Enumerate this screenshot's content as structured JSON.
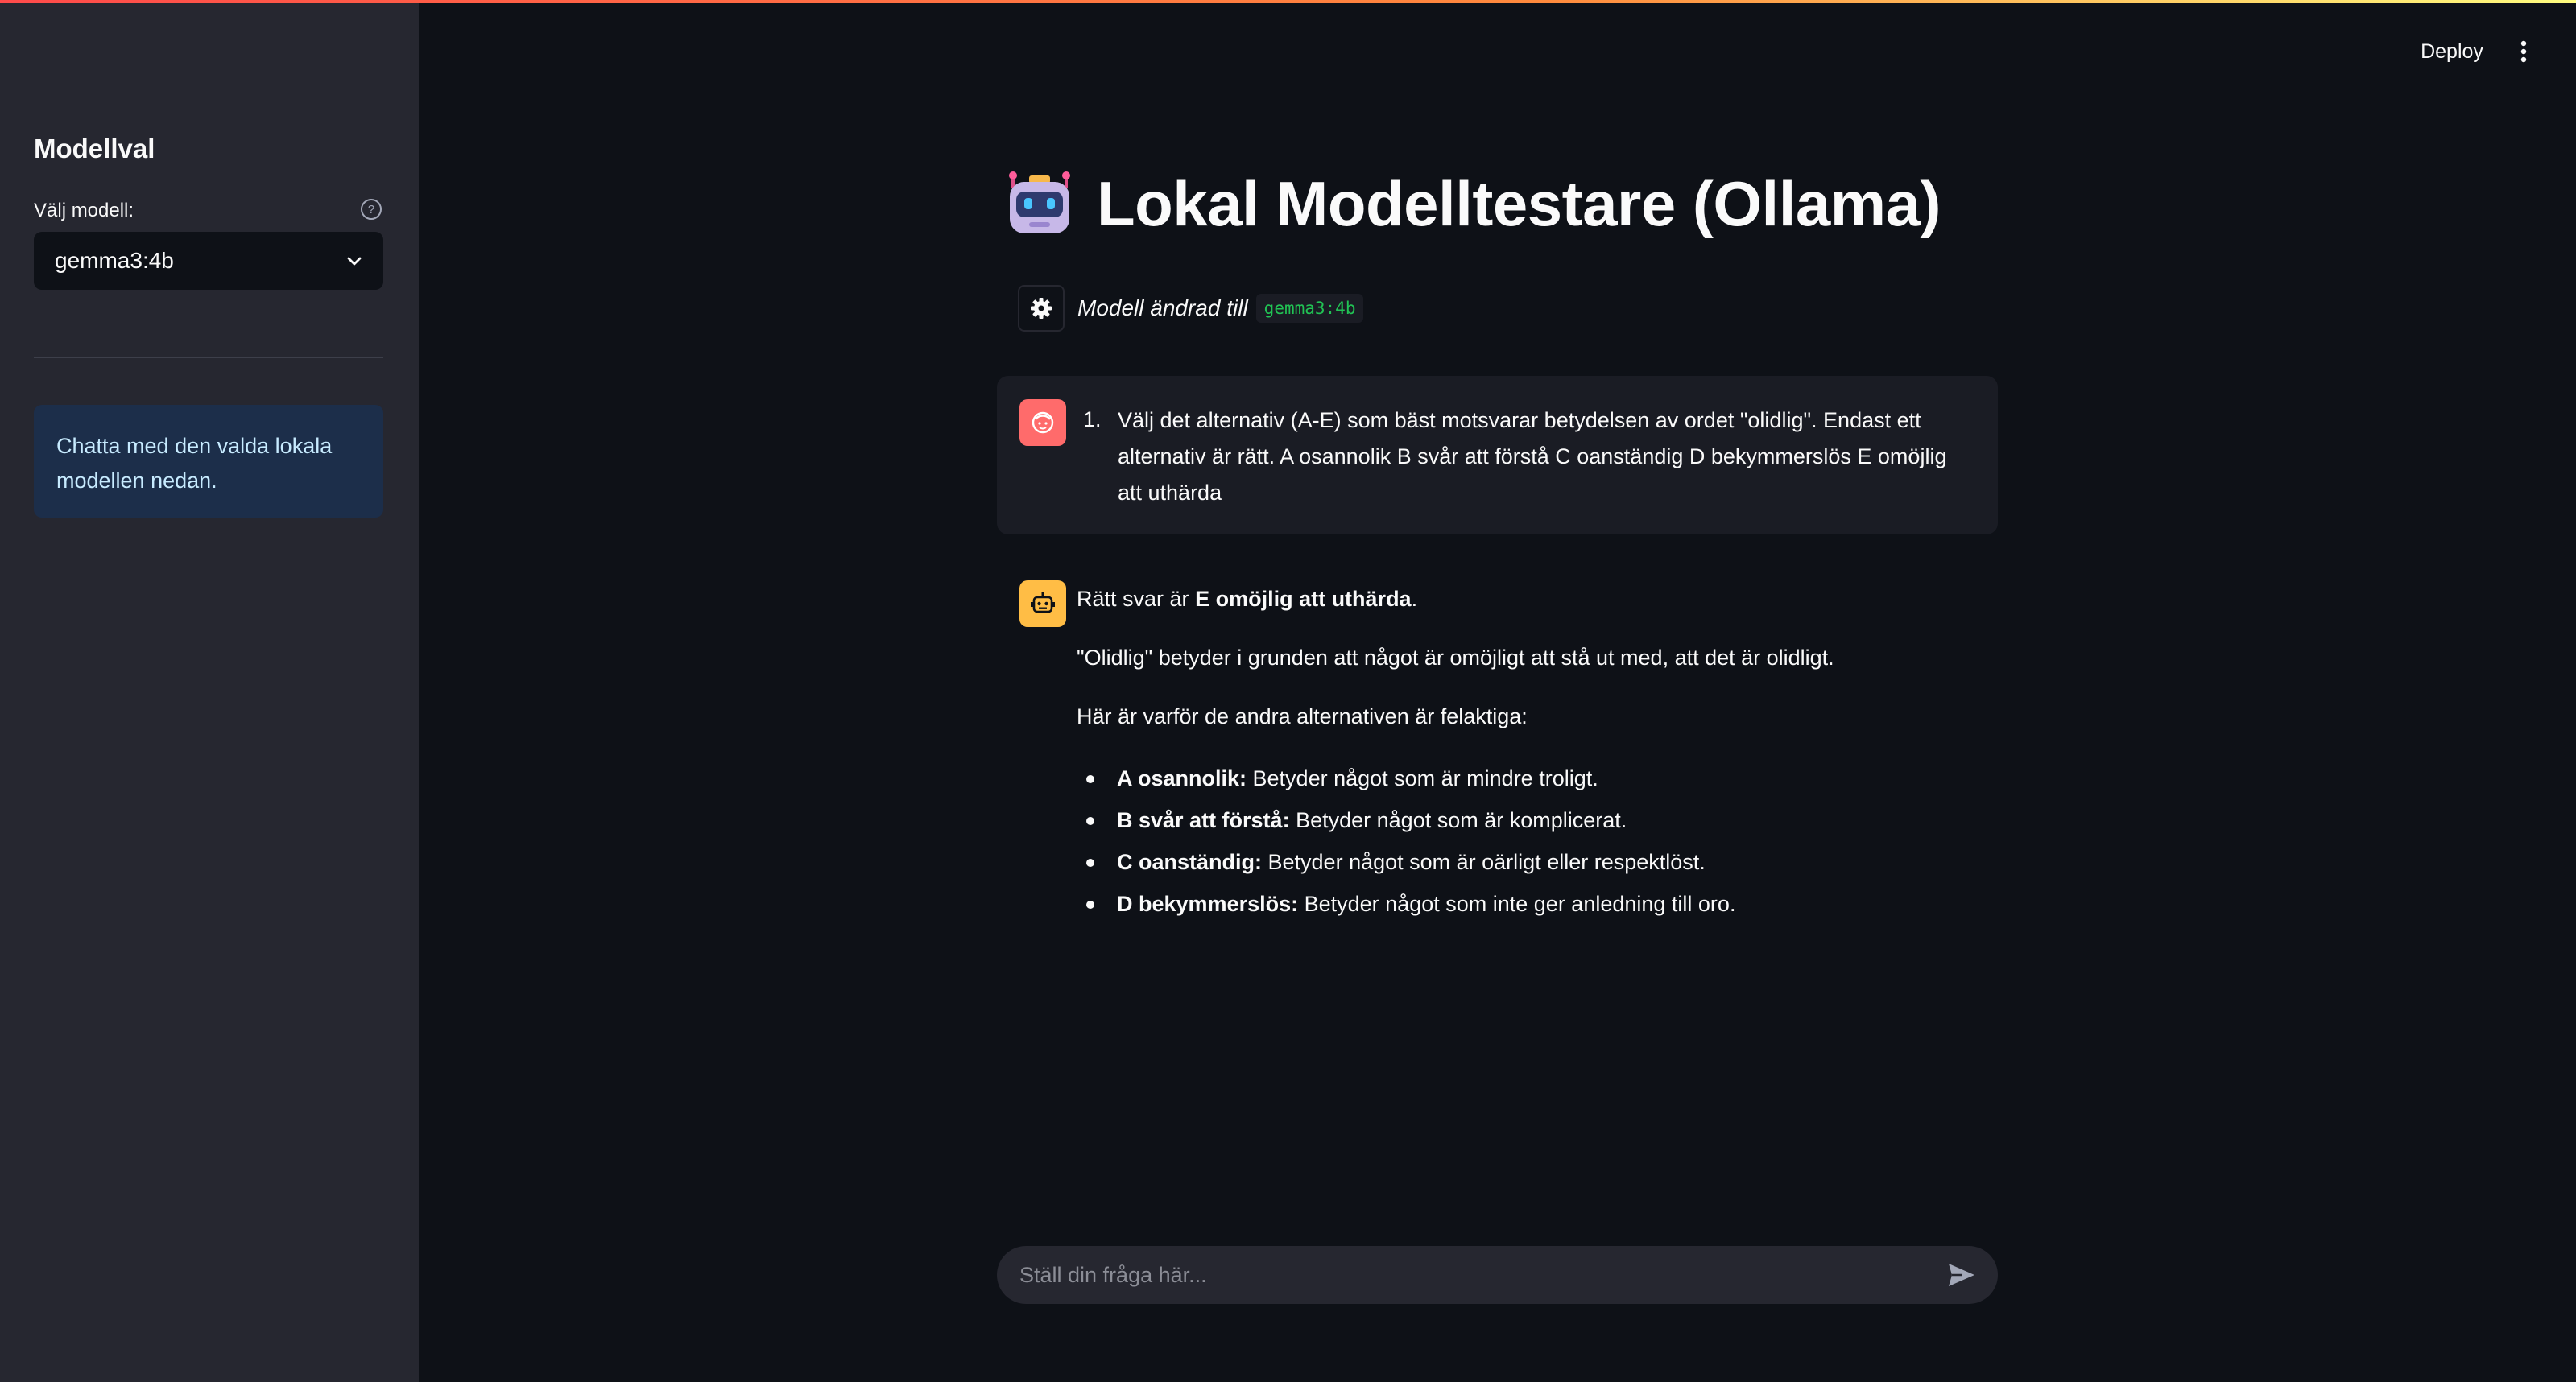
{
  "app": {
    "title": "Lokal Modelltestare (Ollama)",
    "title_icon": "robot-emoji"
  },
  "header": {
    "deploy_label": "Deploy",
    "menu_icon": "vertical-dots-icon"
  },
  "sidebar": {
    "heading": "Modellval",
    "select_label": "Välj modell:",
    "selected_model": "gemma3:4b",
    "info_text": "Chatta med den valda lokala modellen nedan."
  },
  "messages": {
    "system": {
      "icon": "gear-icon",
      "text": "Modell ändrad till",
      "code": "gemma3:4b"
    },
    "user": {
      "number": "1.",
      "text": "Välj det alternativ (A-E) som bäst motsvarar betydelsen av ordet \"olidlig\". Endast ett alternativ är rätt. A osannolik B svår att förstå C oanständig D bekymmerslös E omöjlig att uthärda"
    },
    "assistant": {
      "answer_prefix": "Rätt svar är",
      "answer_bold": "E omöjlig att uthärda",
      "answer_suffix": ".",
      "explanation": "\"Olidlig\" betyder i grunden att något är omöjligt att stå ut med, att det är olidligt.",
      "list_intro": "Här är varför de andra alternativen är felaktiga:",
      "items": [
        {
          "term": "A osannolik:",
          "desc": "Betyder något som är mindre troligt."
        },
        {
          "term": "B svår att förstå:",
          "desc": "Betyder något som är komplicerat."
        },
        {
          "term": "C oanständig:",
          "desc": "Betyder något som är oärligt eller respektlöst."
        },
        {
          "term": "D bekymmerslös:",
          "desc": "Betyder något som inte ger anledning till oro."
        }
      ]
    }
  },
  "chat_input": {
    "placeholder": "Ställ din fråga här..."
  },
  "colors": {
    "background": "#0e1117",
    "sidebar": "#262730",
    "user_avatar": "#ff6b6b",
    "bot_avatar": "#ffbd45",
    "info_bg": "#1c2e4a",
    "code_text": "#21c354"
  }
}
